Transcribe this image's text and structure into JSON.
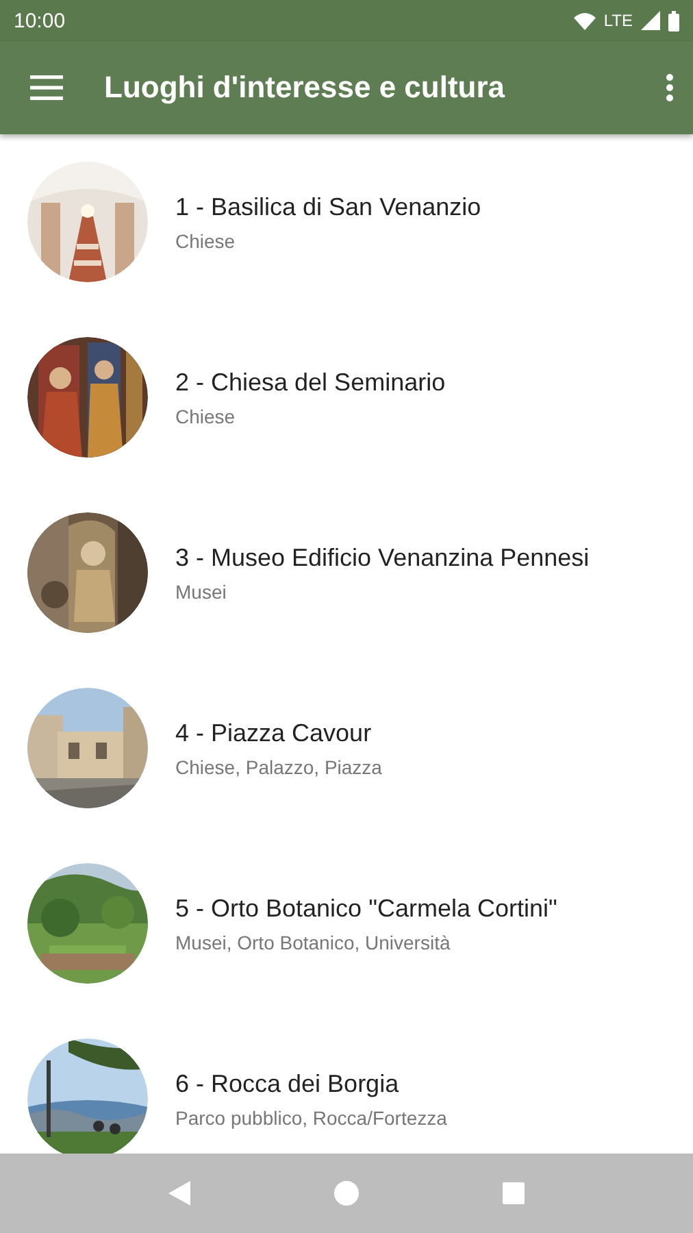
{
  "status_bar": {
    "time": "10:00",
    "network": "LTE"
  },
  "app_bar": {
    "title": "Luoghi d'interesse e cultura"
  },
  "places": [
    {
      "title": "1 - Basilica di San Venanzio",
      "subtitle": "Chiese"
    },
    {
      "title": "2 - Chiesa del Seminario",
      "subtitle": "Chiese"
    },
    {
      "title": "3 - Museo Edificio Venanzina Pennesi",
      "subtitle": "Musei"
    },
    {
      "title": "4 - Piazza Cavour",
      "subtitle": "Chiese, Palazzo, Piazza"
    },
    {
      "title": "5 - Orto Botanico \"Carmela Cortini\"",
      "subtitle": "Musei, Orto Botanico, Università"
    },
    {
      "title": "6 - Rocca dei Borgia",
      "subtitle": "Parco pubblico, Rocca/Fortezza"
    }
  ]
}
